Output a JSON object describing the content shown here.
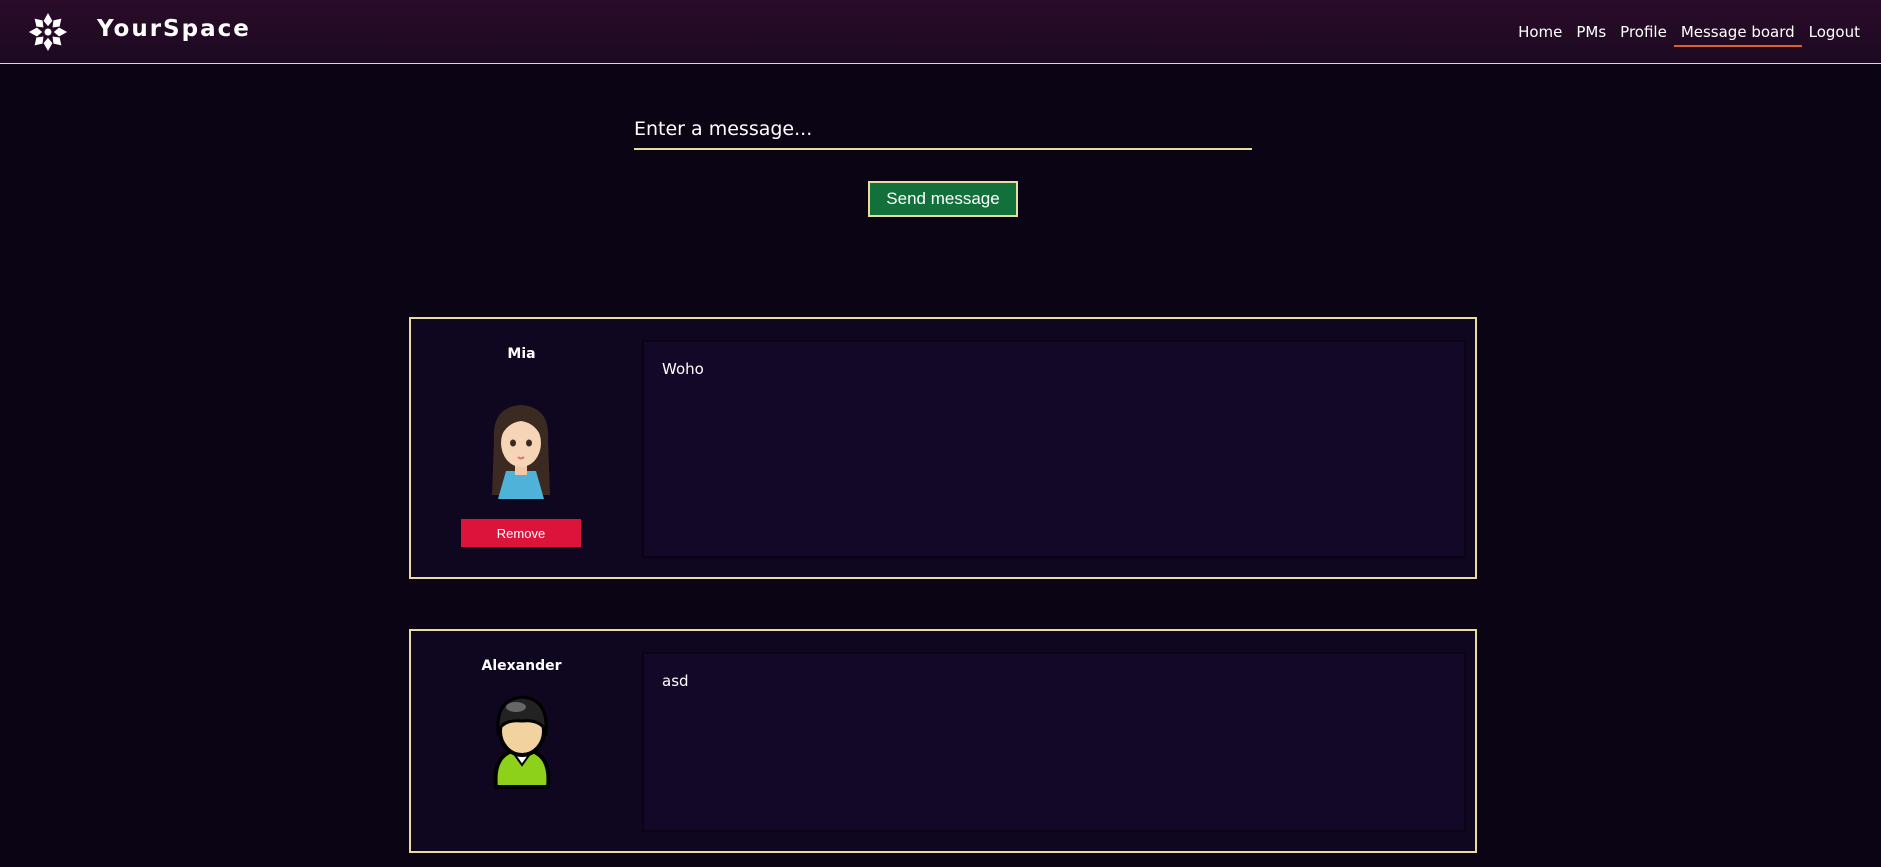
{
  "app": {
    "brand": "YourSpace",
    "logo_icon": "snowflake-logo-icon"
  },
  "nav": {
    "items": [
      {
        "label": "Home",
        "active": false
      },
      {
        "label": "PMs",
        "active": false
      },
      {
        "label": "Profile",
        "active": false
      },
      {
        "label": "Message board",
        "active": true
      },
      {
        "label": "Logout",
        "active": false
      }
    ],
    "active_underline_color": "#e0602a"
  },
  "composer": {
    "placeholder": "Enter a message...",
    "value": "",
    "send_label": "Send message",
    "send_color": "#12703a"
  },
  "posts": [
    {
      "author": "Mia",
      "avatar_icon": "female-avatar-icon",
      "message": "Woho",
      "remove_label": "Remove"
    },
    {
      "author": "Alexander",
      "avatar_icon": "male-avatar-icon",
      "message": "asd"
    }
  ],
  "colors": {
    "background": "#0a0414",
    "accent_border": "#e8dca0",
    "remove": "#dc143c"
  }
}
